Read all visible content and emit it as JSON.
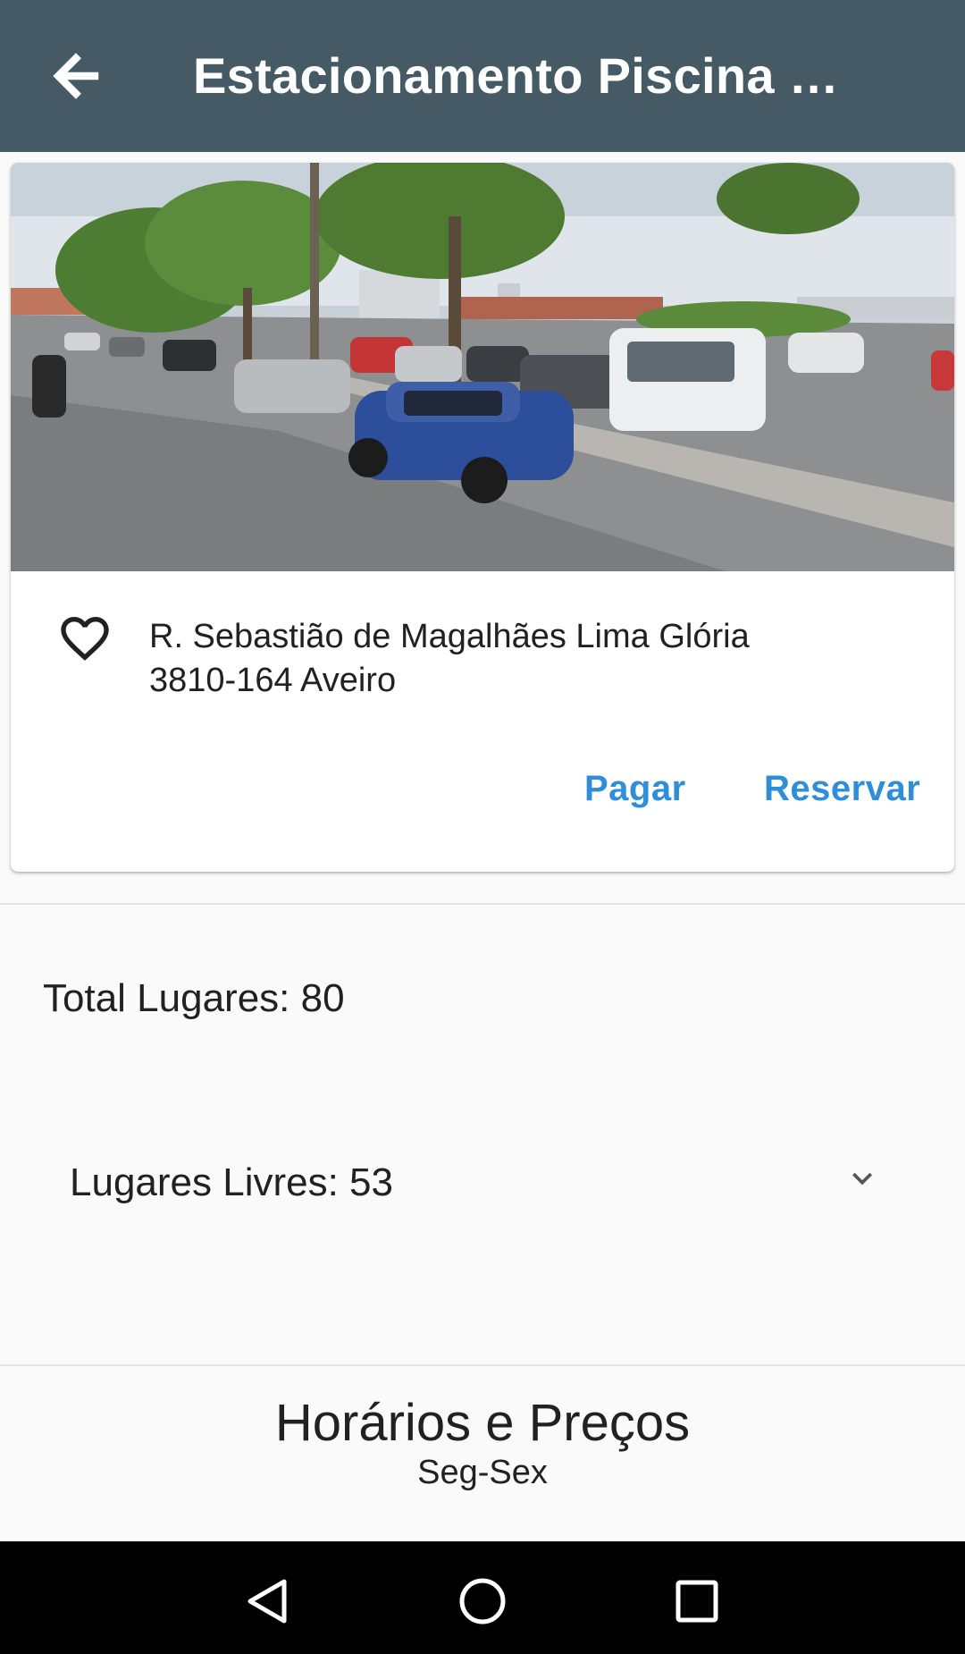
{
  "app_bar": {
    "title": "Estacionamento Piscina …",
    "back_icon": "arrow-back-icon",
    "background": "#455a64"
  },
  "card": {
    "photo_icon": "street-view-photo",
    "favorite_icon": "heart-outline-icon",
    "address_line1": "R. Sebastião de Magalhães Lima Glória",
    "address_line2": "3810-164 Aveiro",
    "actions": {
      "pay_label": "Pagar",
      "reserve_label": "Reservar",
      "accent_color": "#2e8fd8"
    }
  },
  "stats": {
    "total_label": "Total Lugares: 80",
    "free_label": "Lugares Livres: 53",
    "expand_icon": "chevron-down-icon"
  },
  "schedule": {
    "title": "Horários e Preços",
    "subtitle": "Seg-Sex"
  },
  "system_nav": {
    "back_icon": "triangle-back-icon",
    "home_icon": "circle-home-icon",
    "recent_icon": "square-recent-icon"
  }
}
